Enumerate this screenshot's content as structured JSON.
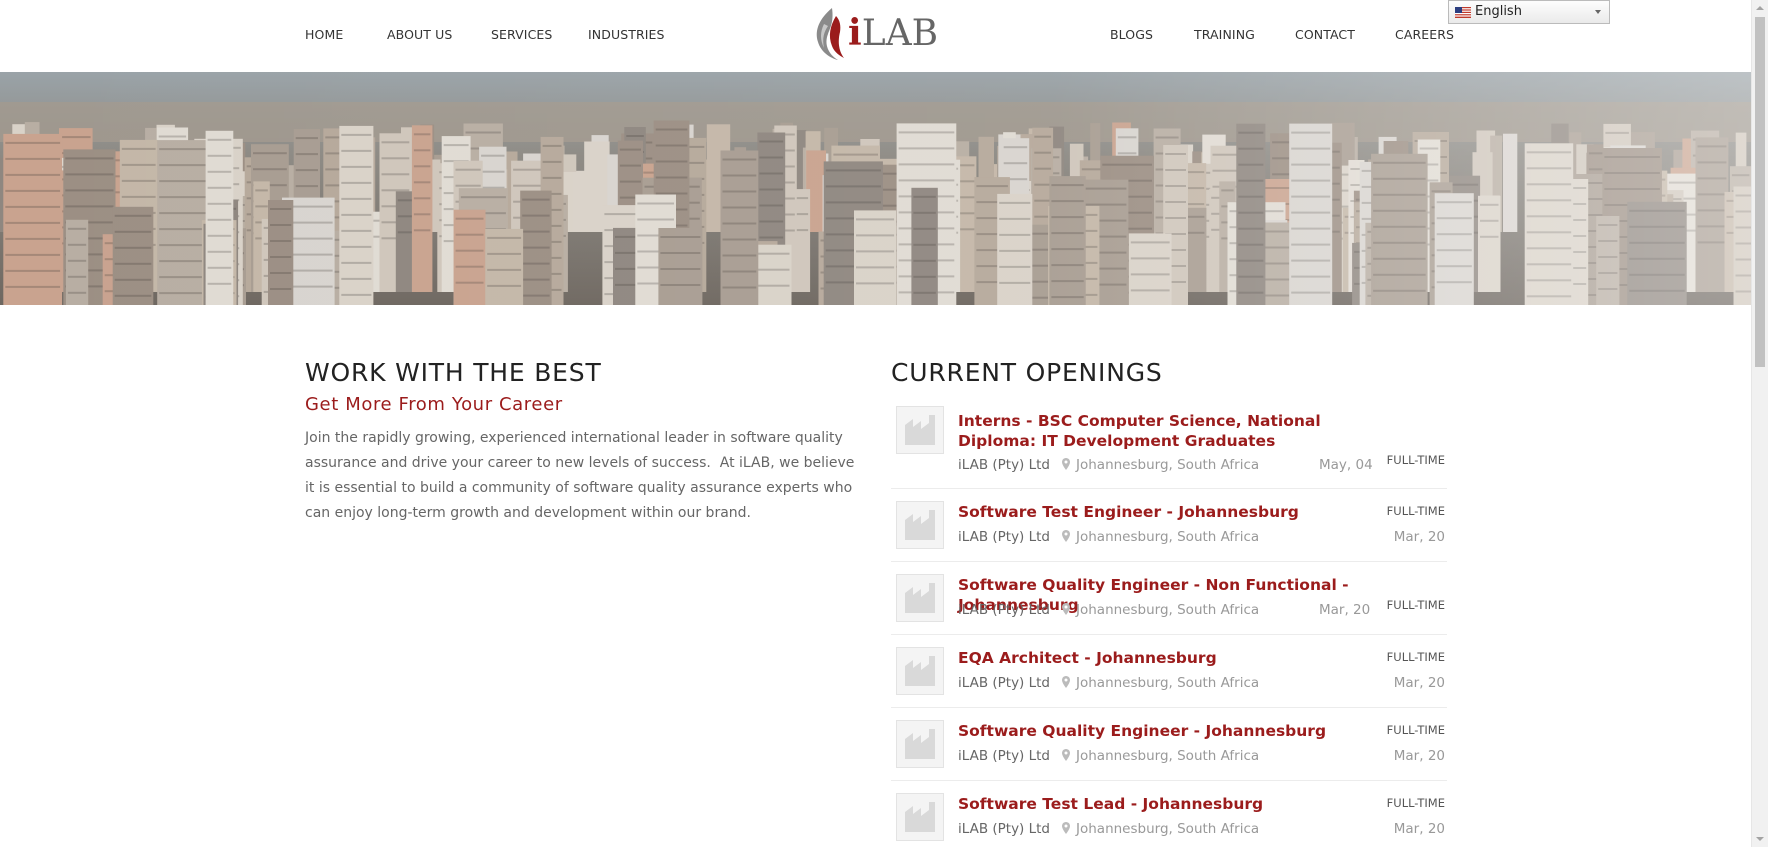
{
  "nav": {
    "left": [
      {
        "label": "HOME"
      },
      {
        "label": "ABOUT US"
      },
      {
        "label": "SERVICES"
      },
      {
        "label": "INDUSTRIES"
      }
    ],
    "right": [
      {
        "label": "BLOGS"
      },
      {
        "label": "TRAINING"
      },
      {
        "label": "CONTACT"
      },
      {
        "label": "CAREERS"
      }
    ],
    "logo_text": "LAB",
    "logo_i": "i"
  },
  "language": {
    "selected": "English",
    "flag_icon": "us-flag-icon"
  },
  "banner": {
    "image": "city-skyline-image"
  },
  "intro": {
    "title": "WORK WITH THE BEST",
    "subtitle": "Get More From Your Career",
    "body": "Join the rapidly growing, experienced international leader in software quality assurance and drive your career to new levels of success.  At iLAB, we believe it is essential to build a community of software quality assurance experts who can enjoy long-term growth and development within our brand."
  },
  "openings": {
    "title": "CURRENT OPENINGS",
    "jobs": [
      {
        "title": "Interns - BSC Computer Science, National Diploma: IT Development Graduates",
        "company": "iLAB (Pty) Ltd",
        "location": "Johannesburg, South Africa",
        "type": "FULL-TIME",
        "date": "May, 04"
      },
      {
        "title": "Software Test Engineer - Johannesburg",
        "company": "iLAB (Pty) Ltd",
        "location": "Johannesburg, South Africa",
        "type": "FULL-TIME",
        "date": "Mar, 20"
      },
      {
        "title": "Software Quality Engineer - Non Functional - Johannesburg",
        "company": "iLAB (Pty) Ltd",
        "location": "Johannesburg, South Africa",
        "type": "FULL-TIME",
        "date": "Mar, 20"
      },
      {
        "title": "EQA Architect - Johannesburg",
        "company": "iLAB (Pty) Ltd",
        "location": "Johannesburg, South Africa",
        "type": "FULL-TIME",
        "date": "Mar, 20"
      },
      {
        "title": "Software Quality Engineer - Johannesburg",
        "company": "iLAB (Pty) Ltd",
        "location": "Johannesburg, South Africa",
        "type": "FULL-TIME",
        "date": "Mar, 20"
      },
      {
        "title": "Software Test Lead - Johannesburg",
        "company": "iLAB (Pty) Ltd",
        "location": "Johannesburg, South Africa",
        "type": "FULL-TIME",
        "date": "Mar, 20"
      }
    ]
  },
  "colors": {
    "accent": "#9b1c1c",
    "text": "#333333",
    "muted": "#999999"
  }
}
